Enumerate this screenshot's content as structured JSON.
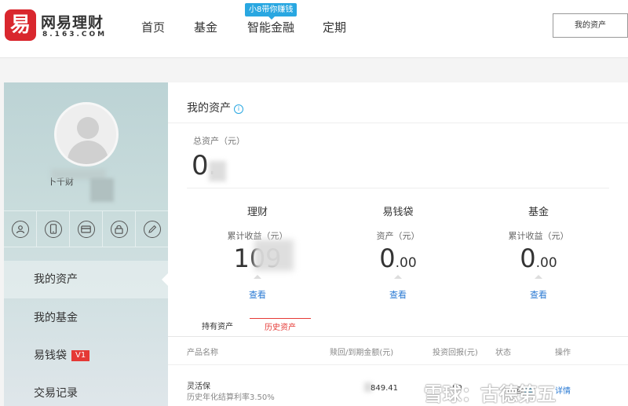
{
  "brand": {
    "name": "网易理财",
    "domain": "8.163.COM"
  },
  "nav": {
    "items": [
      "首页",
      "基金",
      "智能金融",
      "定期"
    ],
    "badge": "小8带你赚钱",
    "asset_button": "我的资产"
  },
  "sidebar": {
    "username": "卜千财",
    "menu": [
      {
        "label": "我的资产",
        "active": true
      },
      {
        "label": "我的基金"
      },
      {
        "label": "易钱袋",
        "badge": "V1"
      },
      {
        "label": "交易记录"
      }
    ],
    "icons": [
      "user-icon",
      "phone-icon",
      "card-icon",
      "lock-icon",
      "pencil-icon"
    ]
  },
  "main": {
    "title": "我的资产",
    "total_label": "总资产（元）",
    "total_value": "0.",
    "summary": [
      {
        "title": "理财",
        "label": "累计收益（元）",
        "value_int": "109",
        "value_dec": "",
        "link": "查看"
      },
      {
        "title": "易钱袋",
        "label": "资产（元）",
        "value_int": "0",
        "value_dec": ".00",
        "link": "查看"
      },
      {
        "title": "基金",
        "label": "累计收益（元）",
        "value_int": "0",
        "value_dec": ".00",
        "link": "查看"
      }
    ],
    "tabs": [
      {
        "label": "持有资产"
      },
      {
        "label": "历史资产",
        "active": true
      }
    ],
    "table": {
      "headers": [
        "产品名称",
        "赎回/到期金额(元)",
        "投资回报(元)",
        "状态",
        "操作"
      ],
      "rows": [
        {
          "name": "灵活保",
          "sub": "历史年化结算利率3.50%",
          "amount": "849.41",
          "return": "80",
          "state": "已回",
          "action": "详情"
        }
      ]
    }
  },
  "watermark": "雪球：古德第五"
}
